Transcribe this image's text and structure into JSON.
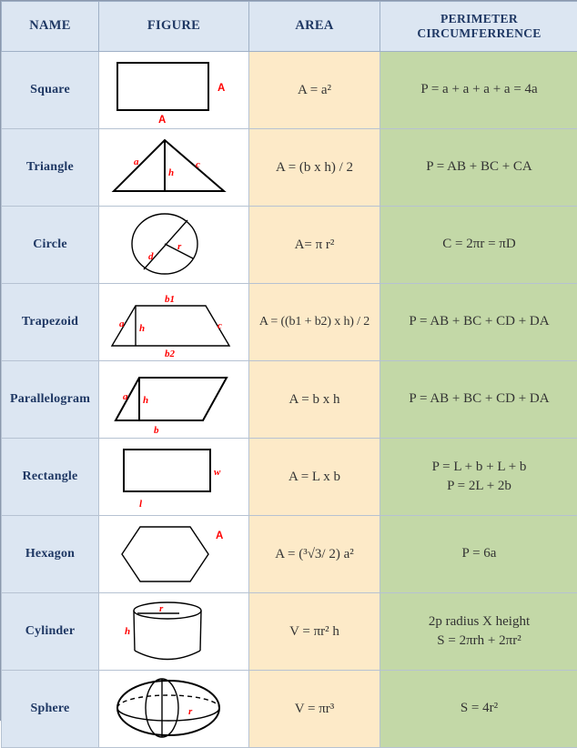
{
  "table": {
    "headers": [
      {
        "label": "NAME",
        "key": "name"
      },
      {
        "label": "FIGURE",
        "key": "figure"
      },
      {
        "label": "AREA",
        "key": "area"
      },
      {
        "label_line1": "PERIMETER",
        "label_line2": "CIRCUMFERRENCE",
        "key": "perimeter"
      }
    ],
    "colors": {
      "header_bg": "#dce6f2",
      "header_text": "#1f3864",
      "name_bg": "#dce6f2",
      "figure_bg": "#ffffff",
      "area_bg": "#fdeac8",
      "perimeter_bg": "#c3d8a7",
      "grid": "#b6c2d2",
      "label_red": "#ff0000",
      "shape_stroke": "#000000"
    },
    "rows": [
      {
        "name": "Square",
        "figure": "square-figure",
        "figure_labels": [
          "A",
          "A"
        ],
        "area": "A = a²",
        "perimeter": [
          "P = a + a + a + a = 4a"
        ]
      },
      {
        "name": "Triangle",
        "figure": "triangle-figure",
        "figure_labels": [
          "a",
          "c",
          "h"
        ],
        "area": "A = (b x h) / 2",
        "perimeter": [
          "P = AB + BC + CA"
        ]
      },
      {
        "name": "Circle",
        "figure": "circle-figure",
        "figure_labels": [
          "d",
          "r"
        ],
        "area": "A= π r²",
        "perimeter": [
          "C = 2πr = πD"
        ]
      },
      {
        "name": "Trapezoid",
        "figure": "trapezoid-figure",
        "figure_labels": [
          "b1",
          "b2",
          "a",
          "c",
          "h"
        ],
        "area": "A = ((b1 + b2) x h) / 2",
        "perimeter": [
          "P = AB + BC + CD + DA"
        ]
      },
      {
        "name": "Parallelogram",
        "figure": "parallelogram-figure",
        "figure_labels": [
          "a",
          "h",
          "b"
        ],
        "area": "A = b x h",
        "perimeter": [
          "P = AB + BC + CD + DA"
        ]
      },
      {
        "name": "Rectangle",
        "figure": "rectangle-figure",
        "figure_labels": [
          "w",
          "l"
        ],
        "area": "A = L x b",
        "perimeter": [
          "P = L + b + L + b",
          "P = 2L + 2b"
        ]
      },
      {
        "name": "Hexagon",
        "figure": "hexagon-figure",
        "figure_labels": [
          "A"
        ],
        "area": "A = (³√3/ 2) a²",
        "perimeter": [
          "P = 6a"
        ]
      },
      {
        "name": "Cylinder",
        "figure": "cylinder-figure",
        "figure_labels": [
          "r",
          "h"
        ],
        "area": "V = πr² h",
        "perimeter": [
          "2p radius X height",
          "S = 2πrh + 2πr²"
        ]
      },
      {
        "name": "Sphere",
        "figure": "sphere-figure",
        "figure_labels": [
          "r"
        ],
        "area": "V =  πr³",
        "perimeter": [
          "S = 4r²"
        ]
      }
    ]
  }
}
